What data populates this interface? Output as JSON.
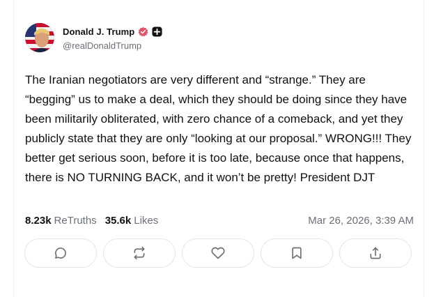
{
  "author": {
    "display_name": "Donald J. Trump",
    "handle": "@realDonaldTrump",
    "verified_color": "#e0556b"
  },
  "post": {
    "text": "The Iranian negotiators are very different and “strange.” They are “begging” us to make a deal, which they should be doing since they have been militarily obliterated, with zero chance of a comeback, and yet they publicly state that they are only “looking at our proposal.” WRONG!!! They better get serious soon, before it is too late, because once that happens, there is NO TURNING BACK, and it won’t be pretty! President DJT"
  },
  "stats": {
    "retruths_count": "8.23k",
    "retruths_label": "ReTruths",
    "likes_count": "35.6k",
    "likes_label": "Likes",
    "timestamp": "Mar 26, 2026, 3:39 AM"
  },
  "actions": [
    {
      "icon": "reply-icon"
    },
    {
      "icon": "retruth-icon"
    },
    {
      "icon": "heart-icon"
    },
    {
      "icon": "bookmark-icon"
    },
    {
      "icon": "share-icon"
    }
  ],
  "colors": {
    "text": "#111111",
    "muted": "#6b6f76",
    "border": "#e4e4e7",
    "icon": "#6b6f76"
  }
}
